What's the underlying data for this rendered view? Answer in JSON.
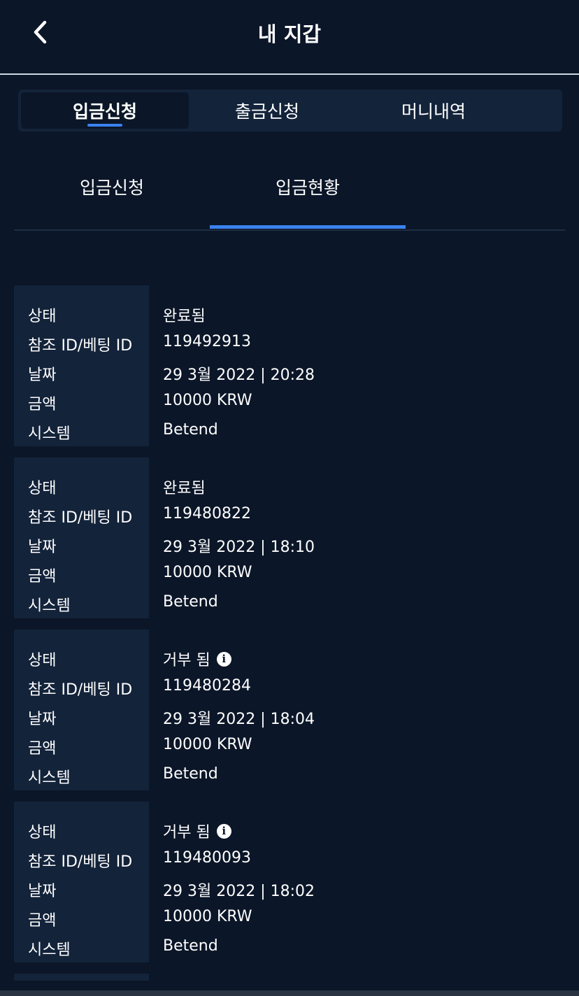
{
  "header": {
    "title": "내 지갑",
    "back_icon": "chevron-left-icon"
  },
  "main_tabs": [
    {
      "label": "입금신청",
      "active": true
    },
    {
      "label": "출금신청",
      "active": false
    },
    {
      "label": "머니내역",
      "active": false
    }
  ],
  "sub_tabs": [
    {
      "label": "입금신청",
      "active": false
    },
    {
      "label": "입금현황",
      "active": true
    }
  ],
  "field_labels": {
    "status": "상태",
    "ref_id": "참조 ID/베팅 ID",
    "date": "날짜",
    "amount": "금액",
    "system": "시스템"
  },
  "records": [
    {
      "status": "완료됨",
      "ref_id": "119492913",
      "date": "29 3월 2022 | 20:28",
      "amount": "10000 KRW",
      "system": "Betend",
      "info": false
    },
    {
      "status": "완료됨",
      "ref_id": "119480822",
      "date": "29 3월 2022 | 18:10",
      "amount": "10000 KRW",
      "system": "Betend",
      "info": false
    },
    {
      "status": "거부 됨",
      "ref_id": "119480284",
      "date": "29 3월 2022 | 18:04",
      "amount": "10000 KRW",
      "system": "Betend",
      "info": true
    },
    {
      "status": "거부 됨",
      "ref_id": "119480093",
      "date": "29 3월 2022 | 18:02",
      "amount": "10000 KRW",
      "system": "Betend",
      "info": true
    }
  ],
  "colors": {
    "background": "#0b1628",
    "panel": "#13233a",
    "accent": "#3a82f0",
    "text": "#ffffff"
  }
}
